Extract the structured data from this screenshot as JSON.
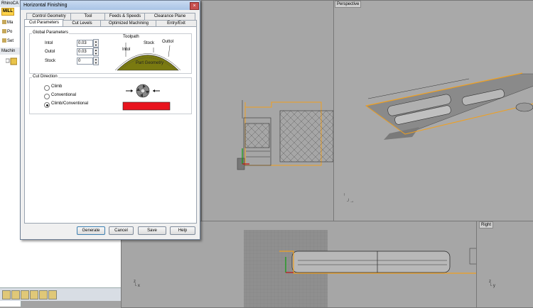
{
  "app": {
    "title_fragment": "RhinoCA",
    "mill_tab": "MILL",
    "browser_items": [
      "Ma",
      "Po",
      "Set"
    ],
    "browser_header": "Machin"
  },
  "dialog": {
    "title": "Horizontal Finishing",
    "tabs_row1": [
      "Control Geometry",
      "Tool",
      "Feeds & Speeds",
      "Clearance Plane"
    ],
    "tabs_row2": [
      "Cut Parameters",
      "Cut Levels",
      "Optimized Machining",
      "Entry/Exit"
    ],
    "active_tab": "Cut Parameters",
    "global_params": {
      "label": "Global Parameters",
      "intol_label": "Intol",
      "intol_value": "0.03",
      "outol_label": "Outol",
      "outol_value": "0.03",
      "stock_label": "Stock",
      "stock_value": "0"
    },
    "diagram": {
      "toolpath": "Toolpath",
      "stock": "Stock",
      "outtol": "Outtol",
      "intol": "Intol",
      "part_geometry": "Part Geometry"
    },
    "cut_direction": {
      "label": "Cut Direction",
      "options": [
        "Climb",
        "Conventional",
        "Climb/Conventional"
      ],
      "selected": "Climb/Conventional"
    },
    "buttons": {
      "generate": "Generate",
      "cancel": "Cancel",
      "save": "Save",
      "help": "Help"
    }
  },
  "viewports": {
    "perspective": "Perspective",
    "right": "Right"
  },
  "colors": {
    "selection_orange": "#f0a020",
    "part_olive": "#7a7a10",
    "tool_red": "#e8141e",
    "titlebar": "#b6cde9"
  }
}
